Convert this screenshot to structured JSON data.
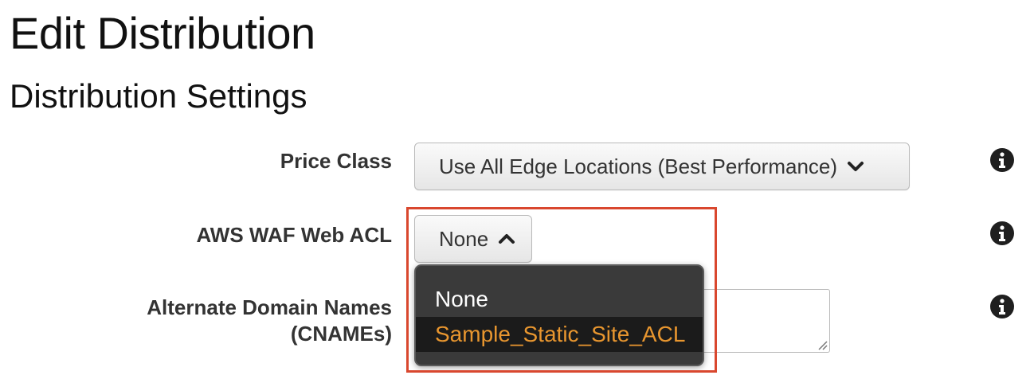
{
  "page": {
    "title": "Edit Distribution",
    "section_title": "Distribution Settings"
  },
  "form": {
    "price_class": {
      "label": "Price Class",
      "selected_value": "Use All Edge Locations (Best Performance)",
      "icon": "chevron-down-icon"
    },
    "waf_web_acl": {
      "label": "AWS WAF Web ACL",
      "selected_value": "None",
      "icon": "chevron-up-icon",
      "expanded": true,
      "options": [
        {
          "label": "None",
          "highlighted": false
        },
        {
          "label": "Sample_Static_Site_ACL",
          "highlighted": true
        }
      ]
    },
    "alternate_domain_names": {
      "label_line1": "Alternate Domain Names",
      "label_line2": "(CNAMEs)",
      "value": ""
    },
    "info_icon": "info-icon"
  },
  "colors": {
    "highlight_outline": "#d9472e",
    "option_highlight_text": "#e8962f",
    "dropdown_background": "#3a3a3a"
  }
}
